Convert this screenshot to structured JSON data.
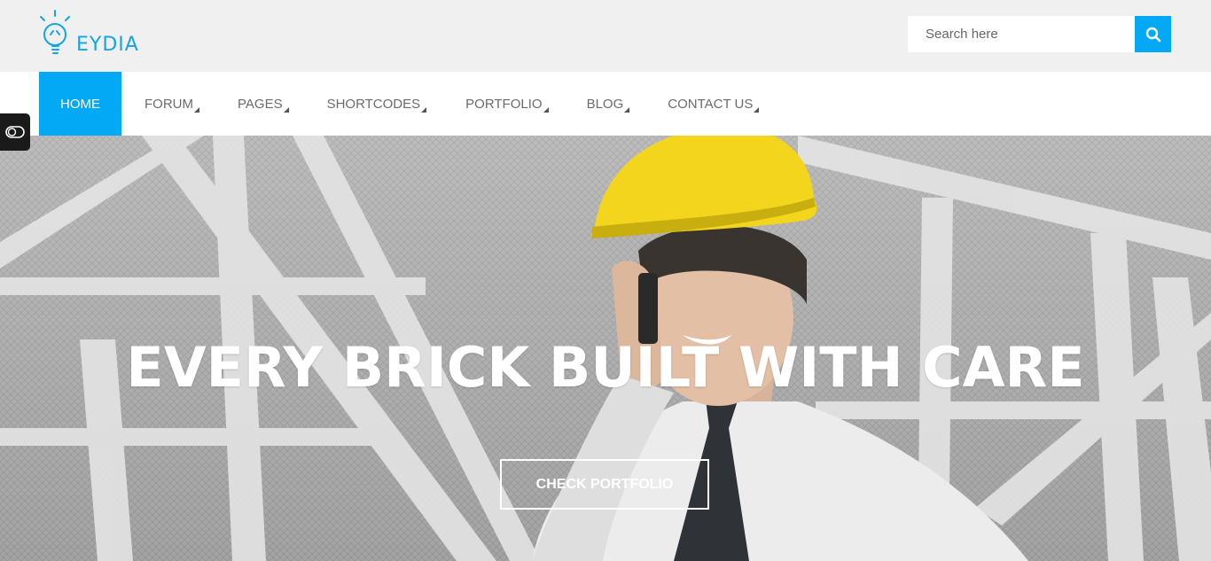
{
  "brand": {
    "name": "EYDIA",
    "accent": "#03a9f4",
    "logo_icon": "lightbulb-icon"
  },
  "search": {
    "placeholder": "Search here",
    "icon": "search-icon"
  },
  "nav": {
    "items": [
      {
        "label": "HOME",
        "active": true
      },
      {
        "label": "FORUM",
        "dropdown": true
      },
      {
        "label": "PAGES",
        "dropdown": true
      },
      {
        "label": "SHORTCODES",
        "dropdown": true
      },
      {
        "label": "PORTFOLIO",
        "dropdown": true
      },
      {
        "label": "BLOG",
        "dropdown": true
      },
      {
        "label": "CONTACT US",
        "dropdown": true
      }
    ]
  },
  "hero": {
    "title": "EVERY BRICK BUILT WITH CARE",
    "cta_label": "CHECK PORTFOLIO",
    "helmet_color": "#f2d51c"
  },
  "side_panel": {
    "icon": "toggle-icon"
  }
}
